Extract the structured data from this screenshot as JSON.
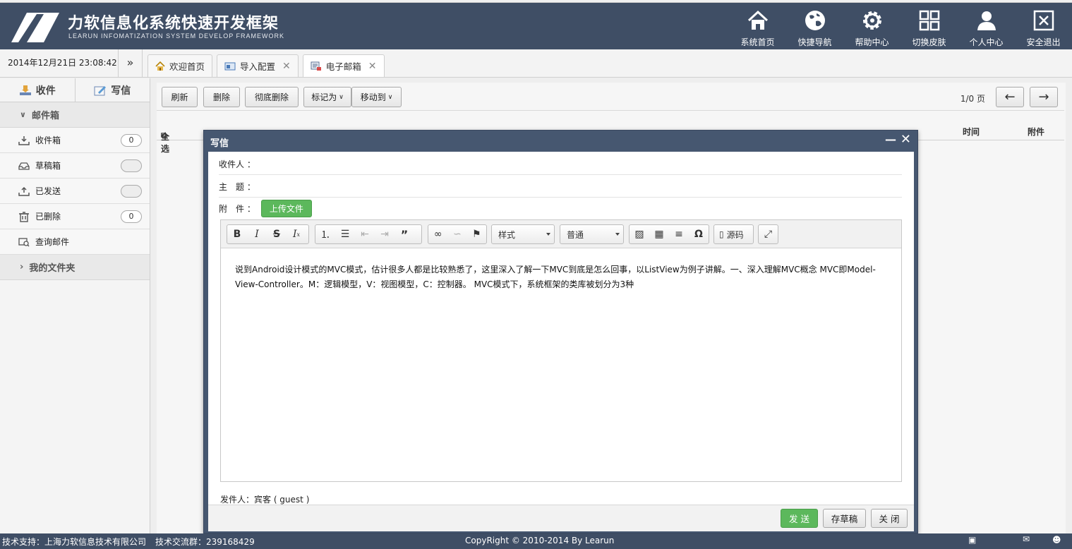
{
  "header": {
    "title": "力软信息化系统快速开发框架",
    "subtitle": "LEARUN INFOMATIZATION SYSTEM DEVELOP FRAMEWORK",
    "nav": [
      {
        "label": "系统首页",
        "icon": "home-icon"
      },
      {
        "label": "快捷导航",
        "icon": "globe-icon"
      },
      {
        "label": "帮助中心",
        "icon": "gear-icon"
      },
      {
        "label": "切换皮肤",
        "icon": "grid-icon"
      },
      {
        "label": "个人中心",
        "icon": "user-icon"
      },
      {
        "label": "安全退出",
        "icon": "exit-icon"
      }
    ]
  },
  "tabbar": {
    "clock": "2014年12月21日 23:08:42",
    "tabs": [
      {
        "label": "欢迎首页",
        "closable": false
      },
      {
        "label": "导入配置",
        "closable": true
      },
      {
        "label": "电子邮箱",
        "closable": true
      }
    ]
  },
  "sidebar": {
    "receive": "收件",
    "compose": "写信",
    "mailbox_group": "邮件箱",
    "items": [
      {
        "label": "收件箱",
        "badge": "0"
      },
      {
        "label": "草稿箱",
        "badge": ""
      },
      {
        "label": "已发送",
        "badge": ""
      },
      {
        "label": "已删除",
        "badge": "0"
      },
      {
        "label": "查询邮件"
      }
    ],
    "folder_group": "我的文件夹"
  },
  "toolbar": {
    "refresh": "刷新",
    "delete": "删除",
    "purge": "彻底删除",
    "mark_as": "标记为",
    "move_to": "移动到",
    "pager": "1/0 页"
  },
  "grid": {
    "select_all": "全选",
    "col_time": "时间",
    "col_attachment": "附件"
  },
  "dialog": {
    "title": "写信",
    "to_label": "收件人 ：",
    "subject_label": "主　题 ：",
    "attach_label": "附　件 ：",
    "upload": "上传文件",
    "style_select": "样式",
    "font_select": "普通",
    "source_label": "源码",
    "content": "说到Android设计模式的MVC模式，估计很多人都是比较熟悉了，这里深入了解一下MVC到底是怎么回事，以ListView为例子讲解。一、深入理解MVC概念 MVC即Model-View-Controller。M：逻辑模型，V：视图模型，C：控制器。 MVC模式下，系统框架的类库被划分为3种",
    "sender": "发件人：宾客 ( guest )",
    "send": "发 送",
    "save_draft": "存草稿",
    "close": "关 闭"
  },
  "footer": {
    "support": "技术支持：上海力软信息技术有限公司",
    "qq_group": "技术交流群：239168429",
    "copyright": "CopyRight © 2010-2014 By Learun"
  },
  "colors": {
    "header_bg": "#3f4e65",
    "dialog_bg": "#465770",
    "accent_green": "#5cb85c"
  }
}
